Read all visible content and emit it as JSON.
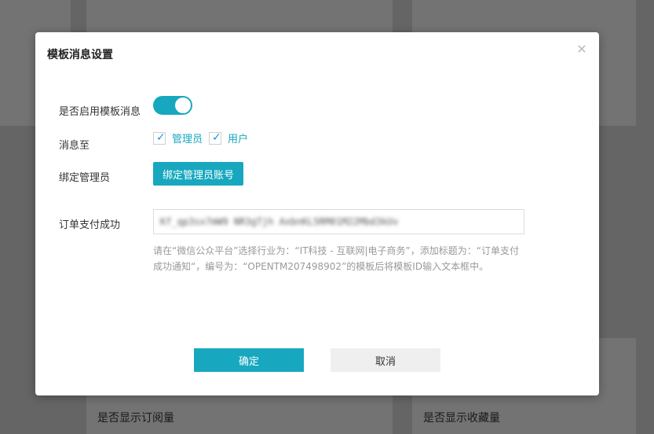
{
  "background": {
    "labels": [
      "是否显示订阅量",
      "是否显示收藏量"
    ]
  },
  "modal": {
    "title": "模板消息设置",
    "close_icon": "close-icon",
    "enable_label": "是否启用模板消息",
    "enable_value": true,
    "notify_label": "消息至",
    "notify_options": [
      {
        "label": "管理员",
        "checked": true
      },
      {
        "label": "用户",
        "checked": true
      }
    ],
    "bind_label": "绑定管理员",
    "bind_button": "绑定管理员账号",
    "order_label": "订单支付成功",
    "order_input_value": "Kf_qp3sx7mW9 NR3gTjh AxbnKL5RM01M22Mbd3kUv",
    "hint_text": "请在“微信公众平台”选择行业为：“IT科技 - 互联网|电子商务”，添加标题为：“订单支付成功通知“，编号为：“OPENTM207498902”的模板后将模板ID输入文本框中。",
    "ok_button": "确定",
    "cancel_button": "取消"
  },
  "colors": {
    "accent": "#17a8bf",
    "check": "#1296db"
  }
}
